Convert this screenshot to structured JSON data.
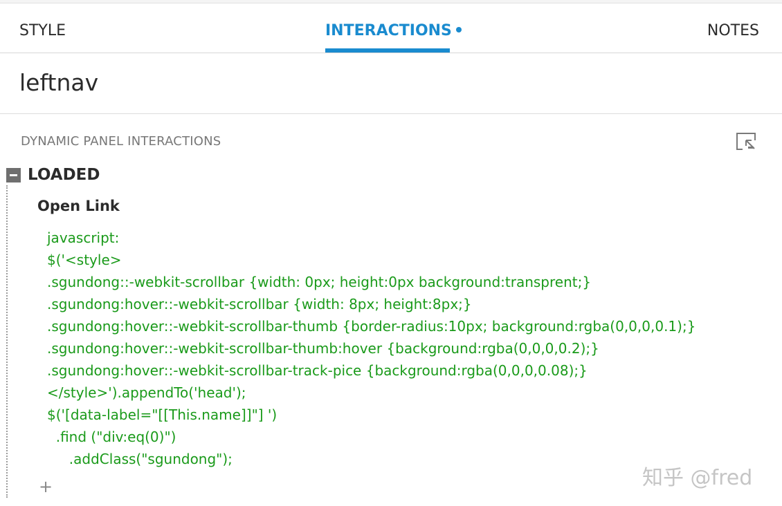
{
  "tabs": [
    {
      "label": "STYLE"
    },
    {
      "label": "INTERACTIONS"
    },
    {
      "label": "NOTES"
    }
  ],
  "active_tab_color": "#1a8bcf",
  "widget": {
    "name": "leftnav"
  },
  "section": {
    "title": "DYNAMIC PANEL INTERACTIONS"
  },
  "event": {
    "label": "LOADED"
  },
  "action": {
    "label": "Open Link"
  },
  "code_lines": [
    "javascript:",
    "$('<style>",
    ".sgundong::-webkit-scrollbar {width: 0px; height:0px background:transprent;}",
    ".sgundong:hover::-webkit-scrollbar {width: 8px; height:8px;}",
    ".sgundong:hover::-webkit-scrollbar-thumb {border-radius:10px; background:rgba(0,0,0,0.1);}",
    ".sgundong:hover::-webkit-scrollbar-thumb:hover {background:rgba(0,0,0,0.2);}",
    ".sgundong:hover::-webkit-scrollbar-track-pice {background:rgba(0,0,0,0.08);}",
    "</style>').appendTo('head');",
    "$('[data-label=\"[[This.name]]\"] ')",
    "  .find (\"div:eq(0)\")",
    "     .addClass(\"sgundong\");"
  ],
  "code_color": "#1a9a1a",
  "add_case": {
    "label": "+"
  },
  "watermark": {
    "text": "知乎 @fred"
  },
  "icons": {
    "organize": "organize-actions-icon",
    "collapse": "collapse-minus-icon",
    "add": "plus-icon"
  }
}
